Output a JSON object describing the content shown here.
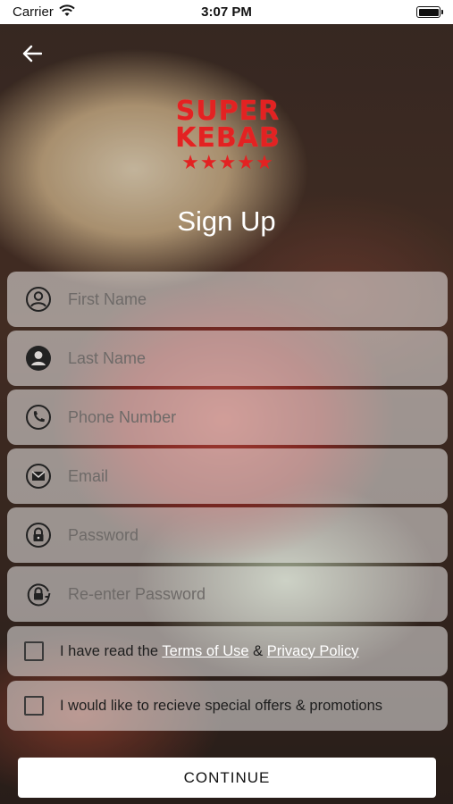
{
  "status_bar": {
    "carrier": "Carrier",
    "time": "3:07 PM"
  },
  "brand": {
    "line1": "SUPER",
    "line2": "KEBAB",
    "stars": "★★★★★",
    "color": "#e32222"
  },
  "title": "Sign Up",
  "fields": {
    "first_name": {
      "placeholder": "First Name",
      "icon": "user-circle-outline-icon"
    },
    "last_name": {
      "placeholder": "Last Name",
      "icon": "user-circle-filled-icon"
    },
    "phone": {
      "placeholder": "Phone Number",
      "icon": "phone-icon"
    },
    "email": {
      "placeholder": "Email",
      "icon": "envelope-icon"
    },
    "password": {
      "placeholder": "Password",
      "icon": "lock-icon"
    },
    "reenter_password": {
      "placeholder": "Re-enter Password",
      "icon": "lock-refresh-icon"
    }
  },
  "terms": {
    "prefix": "I have read the ",
    "terms_link": "Terms of Use",
    "amp": " & ",
    "privacy_link": "Privacy Policy"
  },
  "offers": {
    "label": "I would like to recieve special offers & promotions"
  },
  "continue_label": "CONTINUE"
}
